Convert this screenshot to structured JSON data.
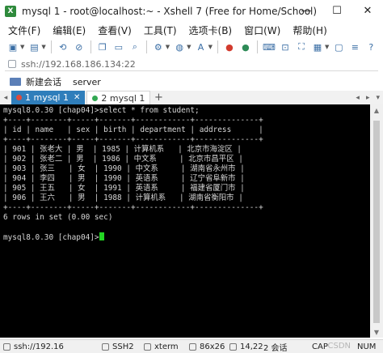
{
  "window": {
    "title": "mysql 1 - root@localhost:~ - Xshell 7 (Free for Home/School)",
    "minimize": "—",
    "maximize": "☐",
    "close": "✕"
  },
  "menu": [
    "文件(F)",
    "编辑(E)",
    "查看(V)",
    "工具(T)",
    "选项卡(B)",
    "窗口(W)",
    "帮助(H)"
  ],
  "address": {
    "value": "ssh://192.168.186.134:22"
  },
  "sessions": {
    "new_session": "新建会话",
    "server": "server"
  },
  "tabs": [
    {
      "label": "1 mysql 1",
      "active": true,
      "color": "#e04a3a"
    },
    {
      "label": "2 mysql 1",
      "active": false,
      "color": "#32a852"
    }
  ],
  "tab_add": "+",
  "terminal": {
    "lines": [
      "mysql8.0.30 [chap04]>select * from student;",
      "+----+--------+-----+-------+------------+--------------+",
      "| id | name   | sex | birth | department | address      |",
      "+----+--------+-----+-------+------------+--------------+",
      "| 901 | 张老大 | 男  | 1985 | 计算机系   | 北京市海淀区 |",
      "| 902 | 张老二 | 男  | 1986 | 中文系     | 北京市昌平区 |",
      "| 903 | 张三   | 女  | 1990 | 中文系     | 湖南省永州市 |",
      "| 904 | 李四   | 男  | 1990 | 英语系     | 辽宁省阜新市 |",
      "| 905 | 王五   | 女  | 1991 | 英语系     | 福建省厦门市 |",
      "| 906 | 王六   | 男  | 1988 | 计算机系   | 湖南省衡阳市 |",
      "+----+--------+-----+-------+------------+--------------+",
      "6 rows in set (0.00 sec)",
      "",
      "mysql8.0.30 [chap04]>"
    ],
    "cursor_color": "#23d623"
  },
  "status": {
    "connection": "ssh://192.16",
    "protocol": "SSH2",
    "terminal": "xterm",
    "size": "86x26",
    "position": "14,22",
    "sessions": "2 会话",
    "caps": "CAP",
    "num": "NUM",
    "watermark": "CSDN"
  }
}
